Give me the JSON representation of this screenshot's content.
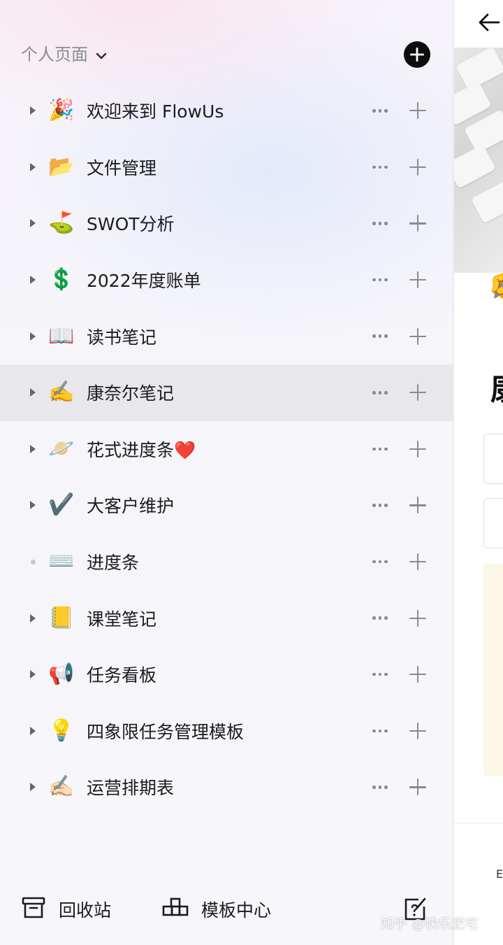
{
  "sidebar": {
    "section_title": "个人页面",
    "pages": [
      {
        "emoji": "🎉",
        "title": "欢迎来到 FlowUs",
        "expandable": true,
        "selected": false
      },
      {
        "emoji": "📂",
        "title": "文件管理",
        "expandable": true,
        "selected": false
      },
      {
        "emoji": "⛳",
        "title": "SWOT分析",
        "expandable": true,
        "selected": false
      },
      {
        "emoji": "💲",
        "title": "2022年度账单",
        "expandable": true,
        "selected": false
      },
      {
        "emoji": "📖",
        "title": "读书笔记",
        "expandable": true,
        "selected": false
      },
      {
        "emoji": "✍️",
        "title": "康奈尔笔记",
        "expandable": true,
        "selected": true
      },
      {
        "emoji": "🪐",
        "title": "花式进度条❤️",
        "expandable": true,
        "selected": false
      },
      {
        "emoji": "✔️",
        "title": "大客户维护",
        "expandable": true,
        "selected": false
      },
      {
        "emoji": "⌨️",
        "title": "进度条",
        "expandable": false,
        "selected": false
      },
      {
        "emoji": "📒",
        "title": "课堂笔记",
        "expandable": true,
        "selected": false
      },
      {
        "emoji": "📢",
        "title": "任务看板",
        "expandable": true,
        "selected": false
      },
      {
        "emoji": "💡",
        "title": "四象限任务管理模板",
        "expandable": true,
        "selected": false
      },
      {
        "emoji": "✍🏻",
        "title": "运营排期表",
        "expandable": true,
        "selected": false
      }
    ]
  },
  "bottom_bar": {
    "trash_label": "回收站",
    "templates_label": "模板中心"
  },
  "right_pane": {
    "emoji": "✍️",
    "title_glyph": "康",
    "bottom_glyph": "E"
  },
  "watermark": "知乎 @快乐肥宅",
  "icons": {
    "expand": "triangle-right-icon",
    "leaf": "dot-icon",
    "more": "more-horizontal-icon",
    "add": "plus-icon",
    "section_add": "plus-circle-icon",
    "trash": "archive-box-icon",
    "templates": "template-blocks-icon",
    "help": "help-edit-icon",
    "back": "arrow-left-icon",
    "chevron": "chevron-down-icon"
  },
  "colors": {
    "text_primary": "#1b1b1f",
    "text_muted": "#8c8c90",
    "selected_bg": "rgba(0,0,0,0.055)",
    "add_button_bg": "#0d0d0d"
  }
}
